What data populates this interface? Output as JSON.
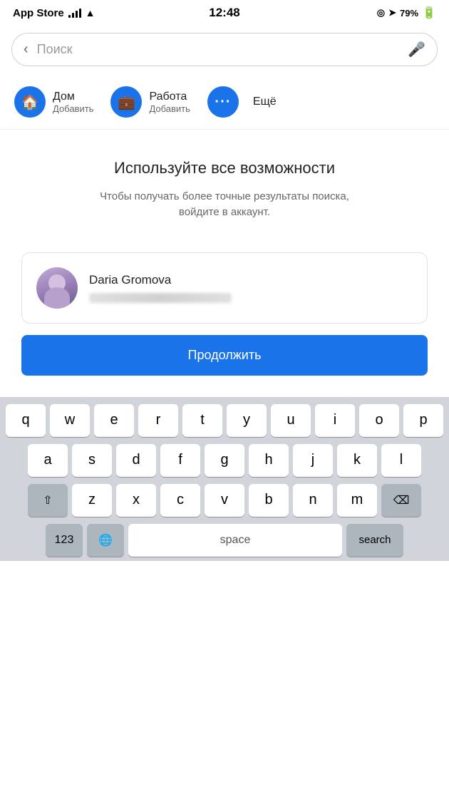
{
  "statusBar": {
    "carrier": "App Store",
    "time": "12:48",
    "battery": "79%"
  },
  "searchBar": {
    "placeholder": "Поиск",
    "backArrow": "‹",
    "micIcon": "🎤"
  },
  "quickLinks": [
    {
      "id": "home",
      "icon": "🏠",
      "title": "Дом",
      "sub": "Добавить"
    },
    {
      "id": "work",
      "icon": "💼",
      "title": "Работа",
      "sub": "Добавить"
    }
  ],
  "moreLabel": "Ещё",
  "promo": {
    "title": "Используйте все возможности",
    "subtitle": "Чтобы получать более точные результаты поиска,\nвойдите в аккаунт."
  },
  "user": {
    "name": "Daria Gromova",
    "emailMasked": "••••••••••••••••••"
  },
  "continueButton": "Продолжить",
  "keyboard": {
    "row1": [
      "q",
      "w",
      "e",
      "r",
      "t",
      "y",
      "u",
      "i",
      "o",
      "p"
    ],
    "row2": [
      "a",
      "s",
      "d",
      "f",
      "g",
      "h",
      "j",
      "k",
      "l"
    ],
    "row3": [
      "z",
      "x",
      "c",
      "v",
      "b",
      "n",
      "m"
    ],
    "spaceLabel": "space",
    "searchLabel": "search",
    "shiftIcon": "⇧",
    "deleteIcon": "⌫",
    "numLabel": "123",
    "globeIcon": "🌐"
  }
}
